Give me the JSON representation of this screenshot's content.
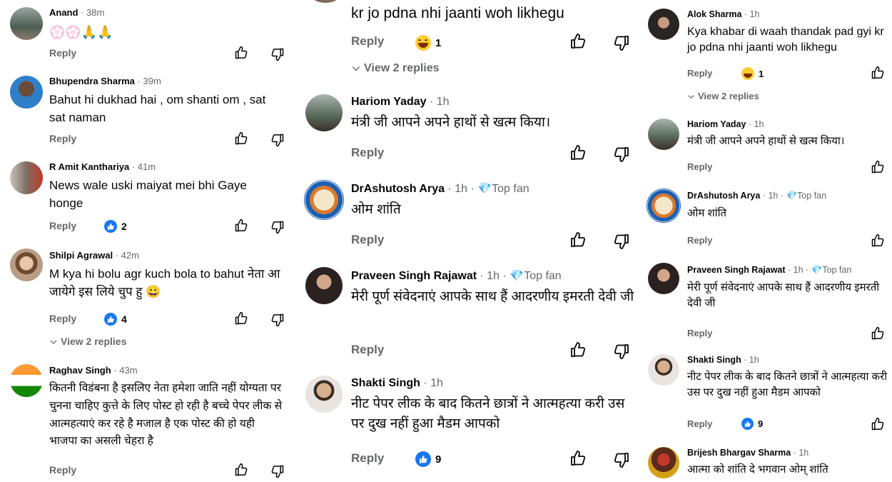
{
  "left": {
    "comments": [
      {
        "name": "Anand",
        "time": "38m",
        "badge": "",
        "text": "💮💮🙏🙏",
        "reply": "Reply",
        "react": ""
      },
      {
        "name": "Bhupendra Sharma",
        "time": "39m",
        "badge": "",
        "text": "Bahut hi dukhad hai , om shanti om , sat sat naman",
        "reply": "Reply",
        "react": ""
      },
      {
        "name": "R Amit Kanthariya",
        "time": "41m",
        "badge": "",
        "text": "News wale uski maiyat mei bhi Gaye honge",
        "reply": "Reply",
        "react": "2"
      },
      {
        "name": "Shilpi Agrawal",
        "time": "42m",
        "badge": "",
        "text": "M kya hi bolu agr kuch bola to bahut नेता आ जायेगे इस लिये चुप हु 😀",
        "reply": "Reply",
        "react": "4",
        "view": "View 2 replies"
      },
      {
        "name": "Raghav Singh",
        "time": "43m",
        "badge": "",
        "text": "कितनी विडंबना है इसलिए नेता हमेशा जाति नहीं योग्यता पर चुनना चाहिए कुत्ते के लिए पोस्ट हो रही है बच्चे पेपर लीक से आत्महत्याएं कर रहे है मजाल है एक पोस्ट की हो यही भाजपा का असली चेहरा है",
        "reply": "Reply",
        "react": ""
      }
    ]
  },
  "middle": {
    "top_text": "kr jo pdna nhi jaanti woh likhegu",
    "top_reply": "Reply",
    "top_react": "1",
    "top_view": "View 2 replies",
    "comments": [
      {
        "name": "Hariom Yaday",
        "time": "1h",
        "badge": "",
        "text": "मंत्री जी आपने अपने हाथों से खत्म किया।",
        "reply": "Reply",
        "react": ""
      },
      {
        "name": "DrAshutosh Arya",
        "time": "1h",
        "badge": "Top fan",
        "text": "ओम शांति",
        "reply": "Reply",
        "react": ""
      },
      {
        "name": "Praveen Singh Rajawat",
        "time": "1h",
        "badge": "Top fan",
        "text": "मेरी पूर्ण संवेदनाएं आपके साथ हैं आदरणीय इमरती देवी जी",
        "reply": "Reply",
        "react": ""
      },
      {
        "name": "Shakti Singh",
        "time": "1h",
        "badge": "",
        "text": "नीट पेपर लीक के बाद कितने छात्रों ने आत्महत्या करी उस पर दुख नहीं हुआ मैडम आपको",
        "reply": "Reply",
        "react": "9"
      }
    ]
  },
  "right": {
    "comments": [
      {
        "name": "Alok Sharma",
        "time": "1h",
        "badge": "",
        "text": "Kya khabar di waah thandak pad gyi kr jo pdna nhi jaanti woh likhegu",
        "reply": "Reply",
        "react": "1",
        "view": "View 2 replies"
      },
      {
        "name": "Hariom Yaday",
        "time": "1h",
        "badge": "",
        "text": "मंत्री जी आपने अपने हाथों से खत्म किया।",
        "reply": "Reply",
        "react": ""
      },
      {
        "name": "DrAshutosh Arya",
        "time": "1h",
        "badge": "Top fan",
        "text": "ओम शांति",
        "reply": "Reply",
        "react": ""
      },
      {
        "name": "Praveen Singh Rajawat",
        "time": "1h",
        "badge": "Top fan",
        "text": "मेरी पूर्ण संवेदनाएं आपके साथ हैं आदरणीय इमरती देवी जी",
        "reply": "Reply",
        "react": ""
      },
      {
        "name": "Shakti Singh",
        "time": "1h",
        "badge": "",
        "text": "नीट पेपर लीक के बाद कितने छात्रों ने आत्महत्या करी उस पर दुख नहीं हुआ मैडम आपको",
        "reply": "Reply",
        "react": "9"
      },
      {
        "name": "Brijesh Bhargav Sharma",
        "time": "1h",
        "badge": "",
        "text": "आत्मा को शांति दे भगवान ओम् शांति",
        "reply": "",
        "react": ""
      }
    ]
  },
  "icons": {
    "like": "thumbs-up-icon",
    "dislike": "thumbs-down-icon",
    "like_badge": "like-reaction-icon",
    "haha": "haha-reaction-icon",
    "chevron": "chevron-down-icon",
    "topfan": "diamond-badge-icon"
  },
  "colors": {
    "accent": "#1877f2",
    "meta": "#65676b",
    "text": "#050505",
    "emoji": "#ffcc33"
  }
}
